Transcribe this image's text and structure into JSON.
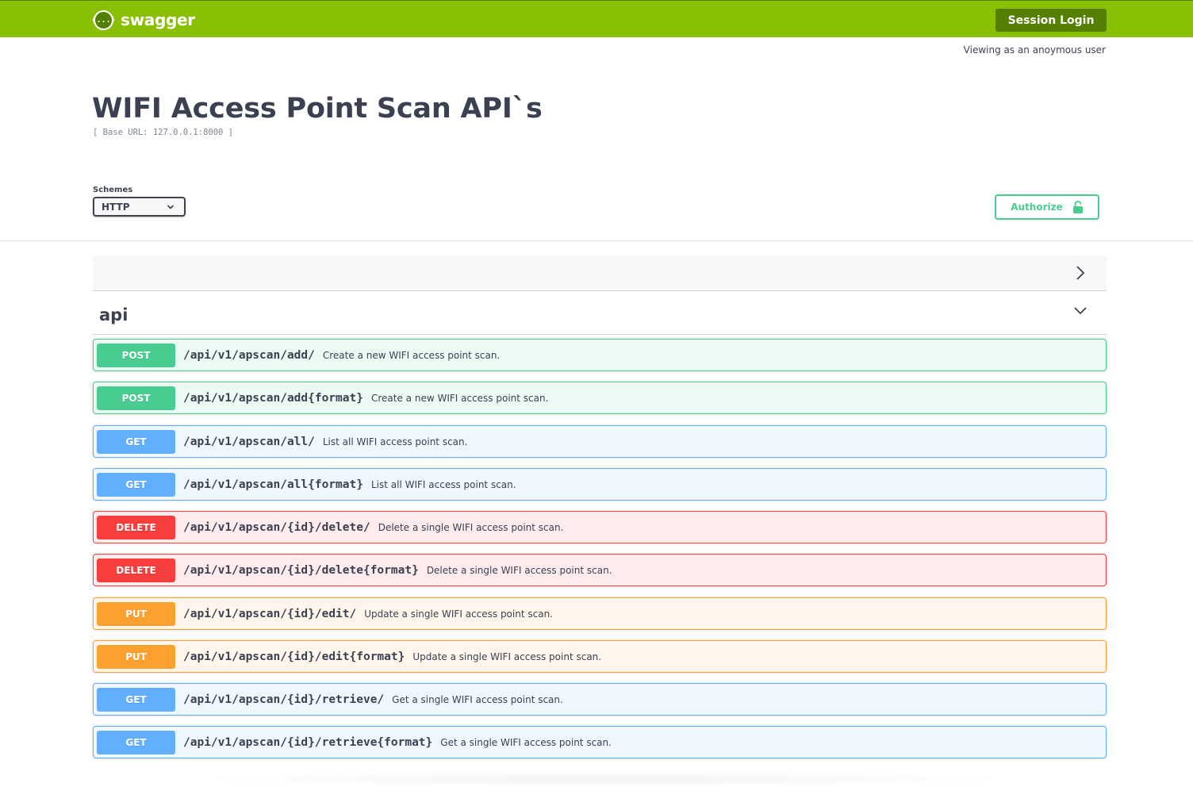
{
  "header": {
    "logo_text": "swagger",
    "logo_badge": "{...}",
    "session_login_label": "Session Login",
    "viewing_text": "Viewing as an anoymous user"
  },
  "info": {
    "title": "WIFI Access Point Scan API`s",
    "base_url": "[ Base URL: 127.0.0.1:8000 ]"
  },
  "schemes": {
    "label": "Schemes",
    "selected": "HTTP"
  },
  "authorize": {
    "label": "Authorize",
    "icon": "lock-icon",
    "color": "#49cc90"
  },
  "tag": {
    "name": "api"
  },
  "colors": {
    "topbar": "#89bf04",
    "topbar_dark": "#547f00",
    "post": "#49cc90",
    "get": "#61affe",
    "delete": "#f93e3e",
    "put": "#fca130"
  },
  "operations": [
    {
      "method": "POST",
      "path": "/api/v1/apscan/add/",
      "description": "Create a new WIFI access point scan."
    },
    {
      "method": "POST",
      "path": "/api/v1/apscan/add{format}",
      "description": "Create a new WIFI access point scan."
    },
    {
      "method": "GET",
      "path": "/api/v1/apscan/all/",
      "description": "List all WIFI access point scan."
    },
    {
      "method": "GET",
      "path": "/api/v1/apscan/all{format}",
      "description": "List all WIFI access point scan."
    },
    {
      "method": "DELETE",
      "path": "/api/v1/apscan/{id}/delete/",
      "description": "Delete a single WIFI access point scan."
    },
    {
      "method": "DELETE",
      "path": "/api/v1/apscan/{id}/delete{format}",
      "description": "Delete a single WIFI access point scan."
    },
    {
      "method": "PUT",
      "path": "/api/v1/apscan/{id}/edit/",
      "description": "Update a single WIFI access point scan."
    },
    {
      "method": "PUT",
      "path": "/api/v1/apscan/{id}/edit{format}",
      "description": "Update a single WIFI access point scan."
    },
    {
      "method": "GET",
      "path": "/api/v1/apscan/{id}/retrieve/",
      "description": "Get a single WIFI access point scan."
    },
    {
      "method": "GET",
      "path": "/api/v1/apscan/{id}/retrieve{format}",
      "description": "Get a single WIFI access point scan."
    }
  ]
}
